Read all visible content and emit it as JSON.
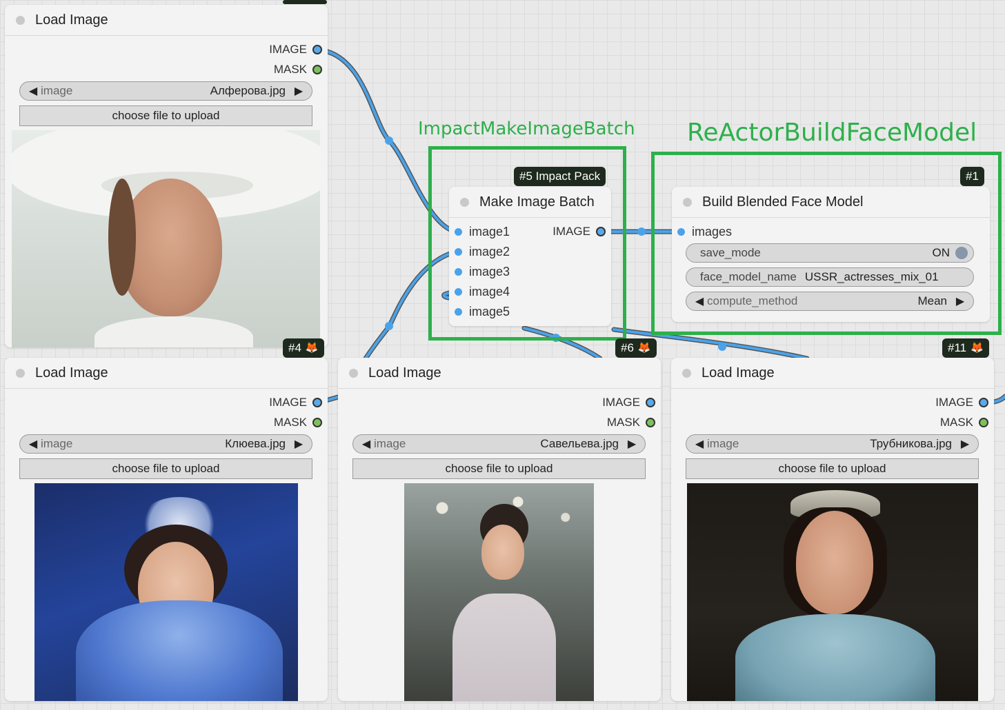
{
  "colors": {
    "group_green": "#2db04b",
    "wire_blue": "#4aa3ea",
    "wire_outline": "#555555",
    "image_port": "#5aa9ea",
    "mask_port": "#7ec05a"
  },
  "groups": [
    {
      "title": "ImpactMakeImageBatch"
    },
    {
      "title": "ReActorBuildFaceModel"
    }
  ],
  "load_nodes": [
    {
      "title": "Load Image",
      "out_image": "IMAGE",
      "out_mask": "MASK",
      "widget_label": "image",
      "filename": "Алферова.jpg",
      "upload_label": "choose file to upload",
      "badge": "#4",
      "badge_icon": "fox-icon"
    },
    {
      "title": "Load Image",
      "out_image": "IMAGE",
      "out_mask": "MASK",
      "widget_label": "image",
      "filename": "Клюева.jpg",
      "upload_label": "choose file to upload",
      "badge": "",
      "badge_icon": ""
    },
    {
      "title": "Load Image",
      "out_image": "IMAGE",
      "out_mask": "MASK",
      "widget_label": "image",
      "filename": "Савельева.jpg",
      "upload_label": "choose file to upload",
      "badge": "#6",
      "badge_icon": "fox-icon"
    },
    {
      "title": "Load Image",
      "out_image": "IMAGE",
      "out_mask": "MASK",
      "widget_label": "image",
      "filename": "Трубникова.jpg",
      "upload_label": "choose file to upload",
      "badge": "#11",
      "badge_icon": "fox-icon"
    }
  ],
  "batch_node": {
    "badge": "#5 Impact Pack",
    "title": "Make Image Batch",
    "inputs": [
      "image1",
      "image2",
      "image3",
      "image4",
      "image5"
    ],
    "output": "IMAGE"
  },
  "face_model_node": {
    "badge": "#1",
    "title": "Build Blended Face Model",
    "input": "images",
    "save_mode_label": "save_mode",
    "save_mode_value": "ON",
    "face_model_name_label": "face_model_name",
    "face_model_name_value": "USSR_actresses_mix_01",
    "compute_method_label": "compute_method",
    "compute_method_value": "Mean"
  }
}
